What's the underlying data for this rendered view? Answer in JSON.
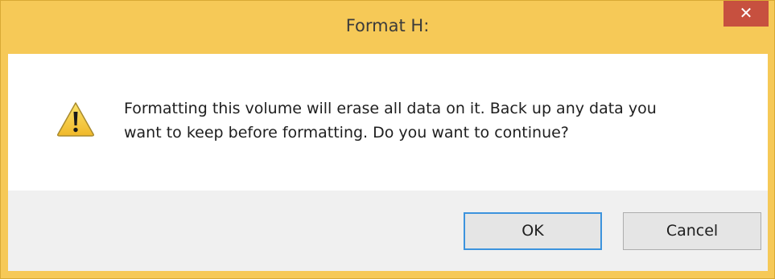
{
  "dialog": {
    "title": "Format H:",
    "close_label": "✕",
    "icon": "warning-icon",
    "message_line1": "Formatting this volume will erase all data on it. Back up any data you",
    "message_line2": "want to keep before formatting. Do you want to continue?",
    "ok_label": "OK",
    "cancel_label": "Cancel"
  },
  "colors": {
    "frame": "#f6c957",
    "close_button": "#c7503f",
    "footer": "#f0f0f0",
    "default_button_border": "#3c93dd"
  }
}
